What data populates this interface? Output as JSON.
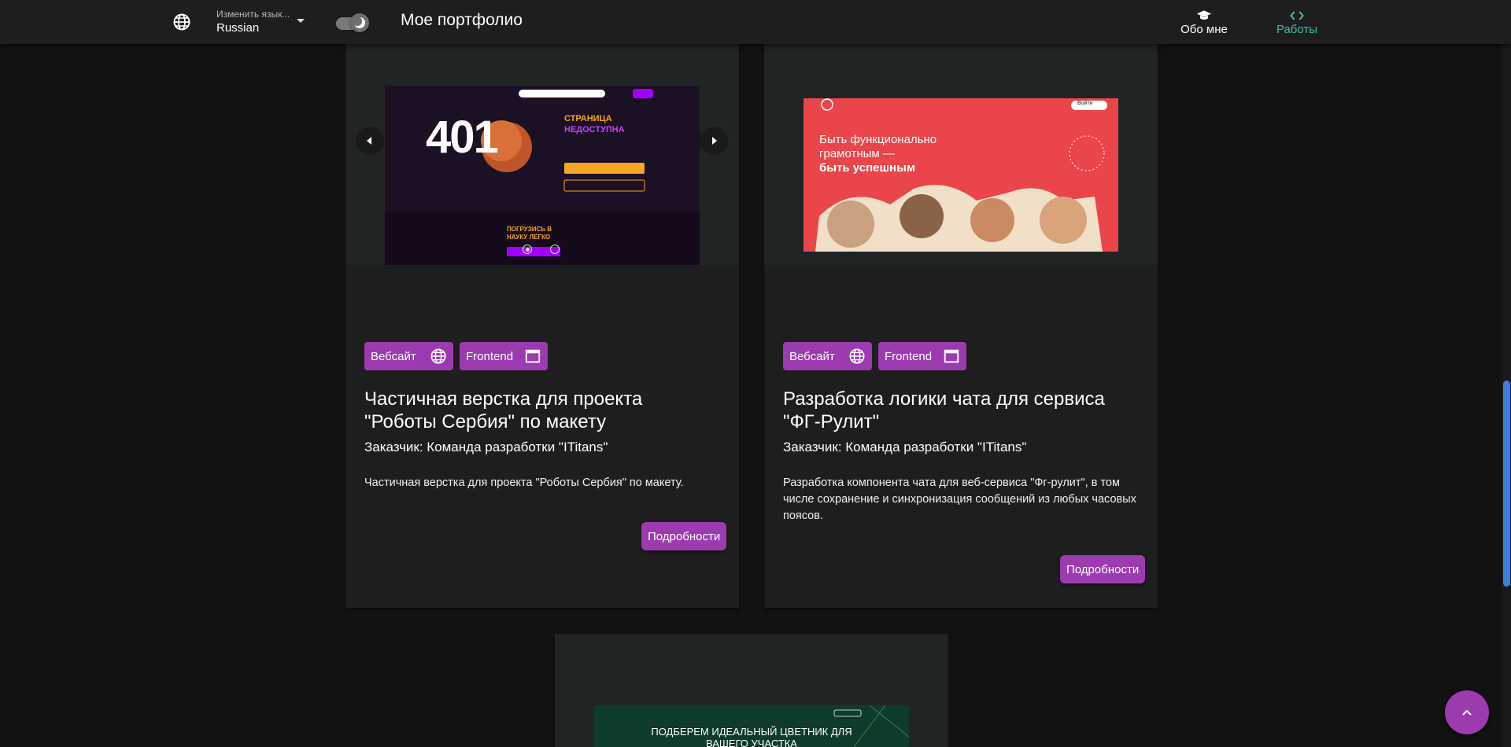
{
  "header": {
    "language_caption": "Изменить язык...",
    "language_value": "Russian",
    "site_title": "Мое портфолио",
    "nav": [
      {
        "label": "Обо мне",
        "icon": "graduation-cap-icon"
      },
      {
        "label": "Работы",
        "icon": "code-icon",
        "active": true
      }
    ],
    "theme_toggle": {
      "icon": "moon-icon",
      "dark_mode": true
    }
  },
  "cards": [
    {
      "tags": [
        {
          "label": "Вебсайт",
          "icon": "globe-icon"
        },
        {
          "label": "Frontend",
          "icon": "window-icon"
        }
      ],
      "title": "Частичная верстка для проекта \"Роботы Сербия\" по макету",
      "client": "Заказчик: Команда разработки \"ITitans\"",
      "description": "Частичная верстка для проекта \"Роботы Сербия\" по макету.",
      "details_label": "Подробности",
      "carousel": {
        "slides": 2,
        "current": 1
      },
      "preview": {
        "big_number": "401",
        "heading_line1": "СТРАНИЦА",
        "heading_line2": "НЕДОСТУПНА",
        "bottom_promo_line1": "ПОГРУЗИСЬ В",
        "bottom_promo_line2": "НАУКУ ЛЕГКО"
      }
    },
    {
      "tags": [
        {
          "label": "Вебсайт",
          "icon": "globe-icon"
        },
        {
          "label": "Frontend",
          "icon": "window-icon"
        }
      ],
      "title": "Разработка логики чата для сервиса \"ФГ-Рулит\"",
      "client": "Заказчик: Команда разработки \"ITitans\"",
      "description": "Разработка компонента чата для веб-сервиса \"Фг-рулит\", в том числе сохранение и синхронизация сообщений из любых часовых поясов.",
      "details_label": "Подробности",
      "preview": {
        "line1": "Быть функционально",
        "line2": "грамотным —",
        "line3": "быть успешным",
        "button": "Войти"
      }
    },
    {
      "preview": {
        "headline_line1": "ПОДБЕРЕМ ИДЕАЛЬНЫЙ ЦВЕТНИК ДЛЯ",
        "headline_line2": "ВАШЕГО УЧАСТКА"
      }
    }
  ],
  "colors": {
    "background": "#121212",
    "surface": "#1e1e1e",
    "accent": "#9c3bb0",
    "nav_active": "#4db6ac",
    "scrollbar": "#3b82e0"
  }
}
